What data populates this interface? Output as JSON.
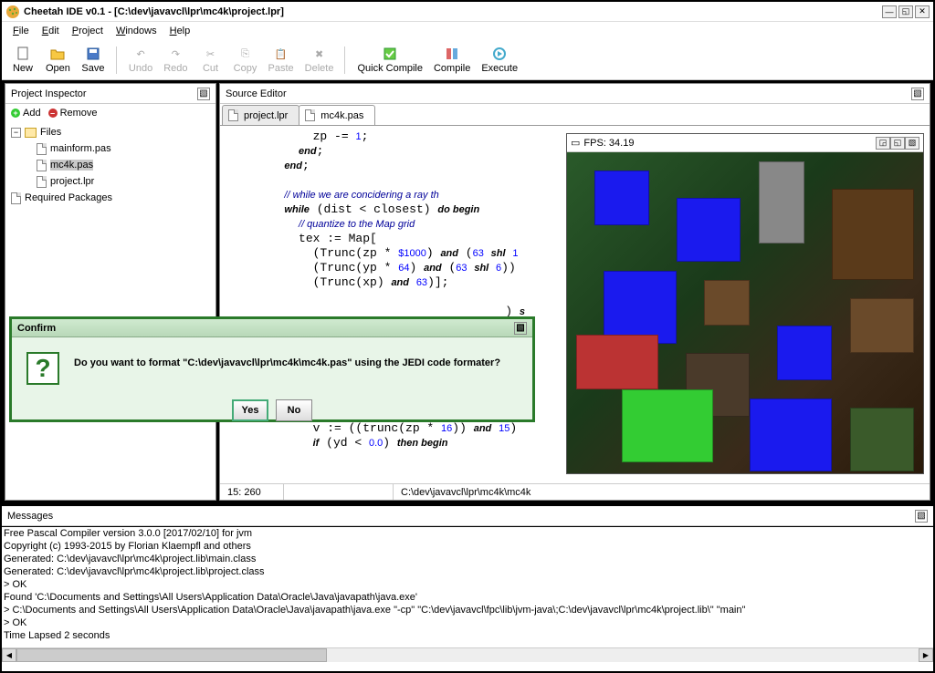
{
  "window": {
    "title": "Cheetah IDE v0.1 - [C:\\dev\\javavcl\\lpr\\mc4k\\project.lpr]"
  },
  "menu": {
    "file": "File",
    "edit": "Edit",
    "project": "Project",
    "windows": "Windows",
    "help": "Help"
  },
  "toolbar": {
    "new": "New",
    "open": "Open",
    "save": "Save",
    "undo": "Undo",
    "redo": "Redo",
    "cut": "Cut",
    "copy": "Copy",
    "paste": "Paste",
    "delete": "Delete",
    "quickcompile": "Quick Compile",
    "compile": "Compile",
    "execute": "Execute"
  },
  "inspector": {
    "title": "Project Inspector",
    "add": "Add",
    "remove": "Remove",
    "files_label": "Files",
    "files": [
      "mainform.pas",
      "mc4k.pas",
      "project.lpr"
    ],
    "required": "Required Packages"
  },
  "editor": {
    "title": "Source Editor",
    "tabs": [
      "project.lpr",
      "mc4k.pas"
    ],
    "status_pos": "15: 260",
    "status_path": "C:\\dev\\javavcl\\lpr\\mc4k\\mc4k"
  },
  "fps": {
    "title": "FPS: 34.19"
  },
  "dialog": {
    "title": "Confirm",
    "text": "Do you want to format \"C:\\dev\\javavcl\\lpr\\mc4k\\mc4k.pas\" using the JEDI code formater?",
    "yes": "Yes",
    "no": "No"
  },
  "messages": {
    "title": "Messages",
    "lines": [
      "Free Pascal Compiler version 3.0.0 [2017/02/10] for jvm",
      "Copyright (c) 1993-2015 by Florian Klaempfl and others",
      "Generated: C:\\dev\\javavcl\\lpr\\mc4k\\project.lib\\main.class",
      "Generated: C:\\dev\\javavcl\\lpr\\mc4k\\project.lib\\project.class",
      "> OK",
      "Found 'C:\\Documents and Settings\\All Users\\Application Data\\Oracle\\Java\\javapath\\java.exe'",
      "> C:\\Documents and Settings\\All Users\\Application Data\\Oracle\\Java\\javapath\\java.exe  \"-cp\"  \"C:\\dev\\javavcl\\fpc\\lib\\jvm-java\\;C:\\dev\\javavcl\\lpr\\mc4k\\project.lib\\\"  \"main\"",
      "> OK",
      "Time Lapsed 2 seconds"
    ]
  }
}
